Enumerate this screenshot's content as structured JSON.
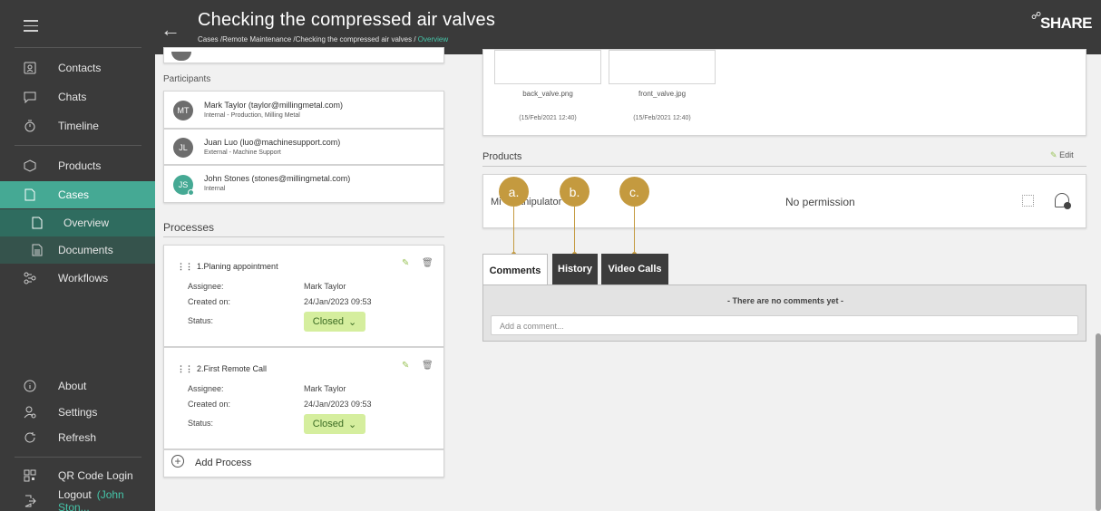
{
  "header": {
    "title": "Checking the compressed air valves",
    "breadcrumb_path": "Cases /Remote Maintenance /Checking the compressed air valves /",
    "breadcrumb_current": "Overview",
    "brand": "SHARE"
  },
  "sidebar": {
    "items": [
      {
        "label": "Contacts",
        "icon": "contact-card-icon"
      },
      {
        "label": "Chats",
        "icon": "chat-bubble-icon"
      },
      {
        "label": "Timeline",
        "icon": "timer-icon"
      },
      {
        "label": "Products",
        "icon": "cube-icon"
      },
      {
        "label": "Cases",
        "icon": "folder-icon"
      },
      {
        "label": "Overview",
        "icon": "page-icon"
      },
      {
        "label": "Documents",
        "icon": "document-icon"
      },
      {
        "label": "Workflows",
        "icon": "workflow-icon"
      }
    ],
    "bottom_items": [
      {
        "label": "About",
        "icon": "info-icon"
      },
      {
        "label": "Settings",
        "icon": "user-gear-icon"
      },
      {
        "label": "Refresh",
        "icon": "refresh-icon"
      },
      {
        "label": "QR Code Login",
        "icon": "qr-code-icon"
      },
      {
        "label": "Logout",
        "icon": "logout-icon"
      }
    ],
    "logout_user": "(John Ston..."
  },
  "participants": {
    "heading": "Participants",
    "list": [
      {
        "initials": "MT",
        "name": "Mark Taylor (taylor@millingmetal.com)",
        "role": "Internal - Production, Milling Metal"
      },
      {
        "initials": "JL",
        "name": "Juan Luo (luo@machinesupport.com)",
        "role": "External - Machine Support"
      },
      {
        "initials": "JS",
        "name": "John Stones (stones@millingmetal.com)",
        "role": "Internal"
      }
    ]
  },
  "processes": {
    "heading": "Processes",
    "assignee_label": "Assignee:",
    "created_label": "Created on:",
    "status_label": "Status:",
    "items": [
      {
        "title": "1.Planing appointment",
        "assignee": "Mark Taylor",
        "created": "24/Jan/2023 09:53",
        "status": "Closed"
      },
      {
        "title": "2.First Remote Call",
        "assignee": "Mark Taylor",
        "created": "24/Jan/2023 09:53",
        "status": "Closed"
      }
    ],
    "add_label": "Add Process"
  },
  "files": [
    {
      "name": "back_valve.png",
      "date": "(15/Feb/2021 12:40)"
    },
    {
      "name": "front_valve.jpg",
      "date": "(15/Feb/2021 12:40)"
    }
  ],
  "products": {
    "heading": "Products",
    "edit_label": "Edit",
    "item_name": "Mi    nanipulator    8",
    "permission_text": "No permission"
  },
  "tabs": [
    {
      "label": "Comments",
      "active": true
    },
    {
      "label": "History",
      "active": false
    },
    {
      "label": "Video Calls",
      "active": false
    }
  ],
  "callouts": [
    "a.",
    "b.",
    "c."
  ],
  "comments": {
    "empty_text": "- There are no comments yet -",
    "placeholder": "Add a comment..."
  },
  "colors": {
    "sidebar_bg": "#3a3a3a",
    "accent_teal": "#45a994",
    "callout_gold": "#c49a3f",
    "status_green": "#d5ee9e"
  }
}
